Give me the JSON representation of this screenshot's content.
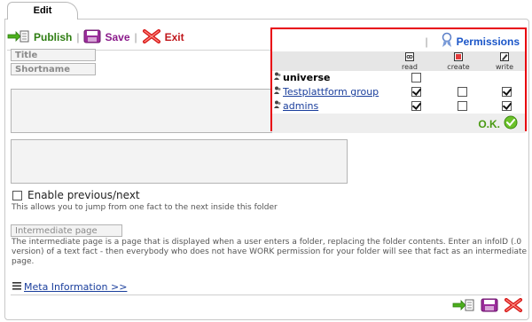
{
  "tab": {
    "label": "Edit"
  },
  "toolbar": {
    "publish_label": "Publish",
    "save_label": "Save",
    "exit_label": "Exit",
    "separator": "|"
  },
  "form": {
    "title_placeholder": "Title",
    "shortname_placeholder": "Shortname",
    "enable_prev_next_label": "Enable previous/next",
    "enable_prev_next_checked": false,
    "enable_prev_next_hint": "This allows you to jump from one fact to the next inside this folder",
    "intermediate_placeholder": "Intermediate page",
    "intermediate_hint": "The intermediate page is a page that is displayed when a user enters a folder, replacing the folder contents. Enter an infoID (.0 version) of a text fact - then everybody who does not have WORK permission for your folder will see that fact as an intermediate page.",
    "meta_link": "Meta Information >>"
  },
  "permissions": {
    "separator": "|",
    "title": "Permissions",
    "columns": [
      "read",
      "create",
      "write"
    ],
    "rows": [
      {
        "name": "universe",
        "link": false,
        "read": false,
        "create": null,
        "write": null
      },
      {
        "name": "Testplattform group",
        "link": true,
        "read": true,
        "create": false,
        "write": true
      },
      {
        "name": "admins",
        "link": true,
        "read": true,
        "create": false,
        "write": true
      }
    ],
    "ok_label": "O.K."
  },
  "colors": {
    "accent_red": "#e8000f",
    "link_blue": "#1a3e9c",
    "publish_green": "#2e7d12",
    "ok_green": "#4a9a13"
  }
}
